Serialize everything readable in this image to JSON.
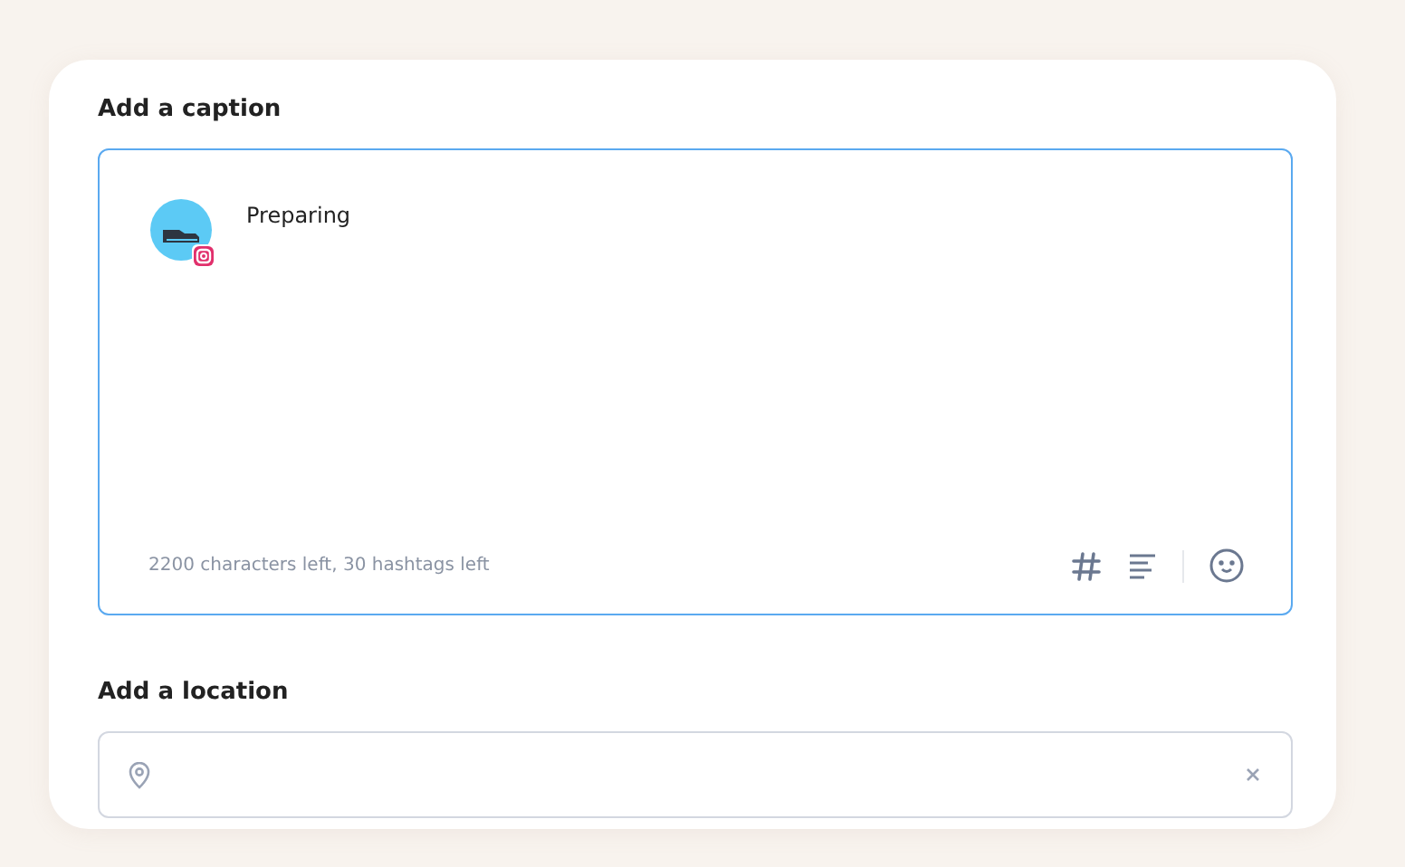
{
  "caption": {
    "heading": "Add a caption",
    "text": "Preparing",
    "counter": "2200 characters left, 30 hashtags left"
  },
  "location": {
    "heading": "Add a location"
  }
}
